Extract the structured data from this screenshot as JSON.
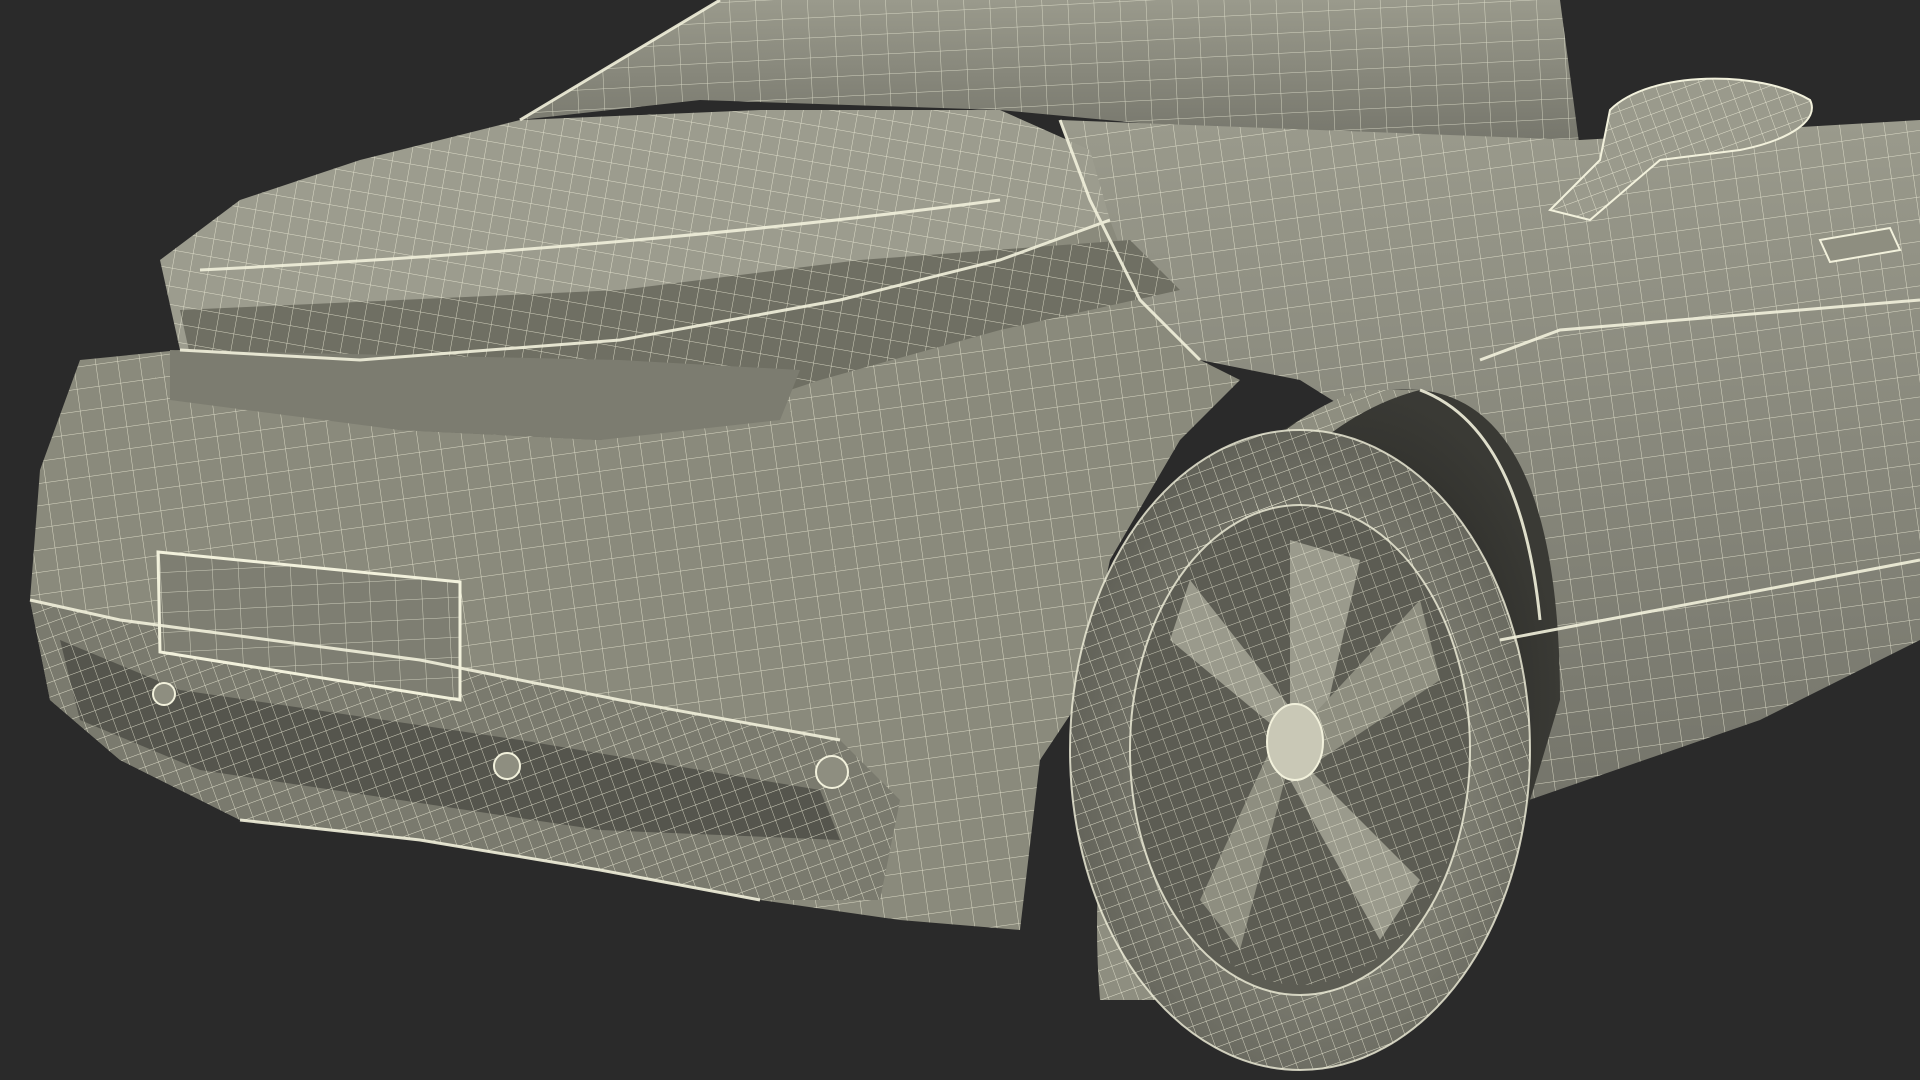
{
  "scene": {
    "subject": "car-wireframe-render",
    "colors": {
      "background": "#2a2a2a",
      "body_fill": "#8b8b7d",
      "body_shade": "#6f6f63",
      "body_dark": "#4e4e46",
      "wire": "#f2f1dc",
      "tire": "#7d7d71",
      "rim": "#5d5d54",
      "grille": "#55554d"
    },
    "icons": [
      "car-body",
      "front-wheel",
      "side-mirror",
      "license-plate",
      "front-grille"
    ]
  }
}
